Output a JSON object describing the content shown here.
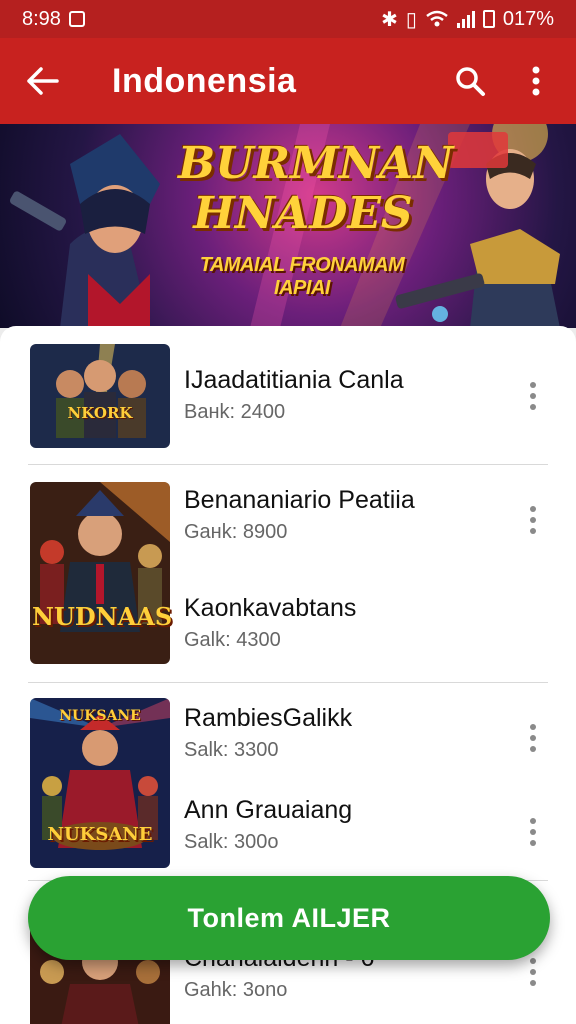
{
  "status_bar": {
    "time": "8:98",
    "battery": "017%"
  },
  "app_bar": {
    "title": "Indonensia",
    "back_icon": "arrow-back-icon",
    "search_icon": "search-icon",
    "menu_icon": "more-vert-icon"
  },
  "banner": {
    "title_line1": "BURMNAN",
    "title_line2": "HNADES",
    "tagline": "TAMAIAL FRONAMAM IAPIAI"
  },
  "items": [
    {
      "name": "IJaadatitiania Canla",
      "sub": "Baнk: 2400",
      "thumb_label": "NKORK"
    },
    {
      "name": "Benananiario Peatiia",
      "sub": "Gaнk: 8900",
      "thumb_label": "NUDNAAS"
    },
    {
      "name": "Kaonkavabtans",
      "sub": "Galk: 4300"
    },
    {
      "name": "RambiesGalikk",
      "sub": "Salk: 3300",
      "thumb_label": "NUKSANE"
    },
    {
      "name": "Ann Grauaiang",
      "sub": "Salk: 300o"
    },
    {
      "name": "Cnanaiaidenn - 6",
      "sub": "Gahk: 3ono"
    }
  ],
  "fab": {
    "label": "Tonlem AILJER"
  },
  "colors": {
    "appbar": "#c8221f",
    "status": "#b5201f",
    "fab": "#2aa233"
  }
}
